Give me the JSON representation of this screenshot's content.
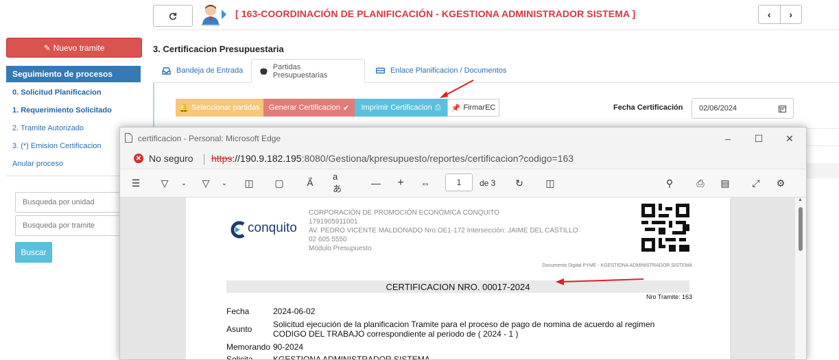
{
  "header": {
    "title": "[ 163-COORDINACIÓN DE PLANIFICACIÓN - KGESTIONA ADMINISTRADOR SISTEMA ]",
    "refresh_icon": "refresh-icon",
    "prev_icon": "chevron-left-icon",
    "next_icon": "chevron-right-icon"
  },
  "sidebar": {
    "new_button": "Nuevo tramite",
    "section_title": "Seguimiento de procesos",
    "items": [
      {
        "label": "0. Solicitud Planificacion",
        "bold": true
      },
      {
        "label": "1. Requerimiento Solicitado",
        "bold": true
      },
      {
        "label": "2. Tramite Autorizado",
        "bold": false
      },
      {
        "label": "3. (*) Emision Certificacion",
        "bold": false
      },
      {
        "label": "Anular proceso",
        "bold": false
      }
    ],
    "search_unit_placeholder": "Busqueda por unidad",
    "search_tramite_placeholder": "Busqueda por tramite",
    "search_button": "Buscar"
  },
  "main": {
    "section_title": "3. Certificacion Presupuestaria",
    "tabs": [
      {
        "label": "Bandeja de Entrada",
        "icon": "inbox-icon"
      },
      {
        "label": "Partidas Presupuestarias",
        "icon": "apple-icon"
      },
      {
        "label": "Enlace Planificacion / Documentos",
        "icon": "link-icon"
      }
    ],
    "buttons": {
      "select": "Seleccionar partidas",
      "generate": "Generar Certificacion",
      "print": "Imprimir Certificacion",
      "sign": "FirmarEC"
    },
    "fecha_label": "Fecha Certificación",
    "fecha_value": "02/06/2024"
  },
  "browser": {
    "window_title": "certificacion - Personal: Microsoft Edge",
    "not_secure": "No seguro",
    "url_scheme": "https",
    "url_host": "://190.9.182.195",
    "url_rest": ":8080/Gestiona/kpresupuesto/reportes/certificacion?codigo=163",
    "page_number": "1",
    "page_of": "de 3"
  },
  "document": {
    "logo_text": "conquito",
    "company": "CORPORACIÓN DE PROMOCIÓN ECONÓMICA CONQUITO",
    "ruc": "1791905911001",
    "address": "AV. PEDRO VICENTE MALDONADO Nro.OE1-172 Intersección: JAIME DEL CASTILLO",
    "phone": "02 605 5550",
    "module": "Módulo Presupuesto",
    "digital_doc": "Documento Digital PYME - KGESTIONA ADMINISTRADOR SISTEMA",
    "cert_title": "CERTIFICACION NRO. 00017-2024",
    "nro_tramite": "Nro Tramite: 163",
    "fecha_label": "Fecha",
    "fecha_value": "2024-06-02",
    "asunto_label": "Asunto",
    "asunto_line1": "Solicitud ejecución de la planificacion Tramite para el proceso de pago de nomina de acuerdo al regimen",
    "asunto_line2": "CODIGO DEL TRABAJO correspondiente al periodo de ( 2024 - 1 )",
    "memorando_label": "Memorando",
    "memorando_value": "90-2024",
    "solicita_label": "Solicita",
    "solicita_value": "KGESTIONA ADMINISTRADOR SISTEMA"
  }
}
